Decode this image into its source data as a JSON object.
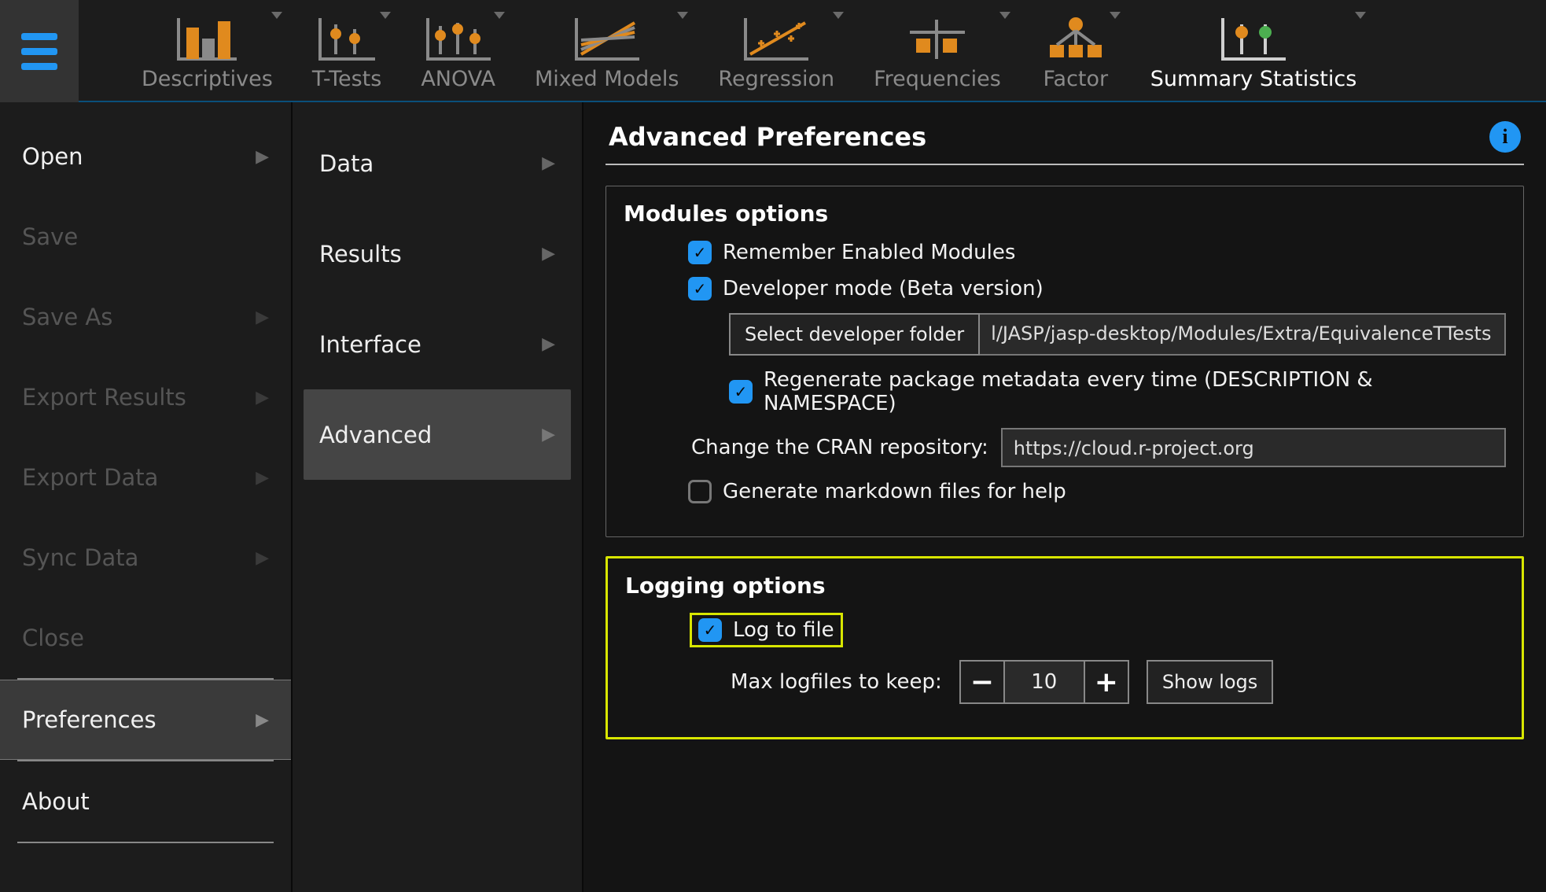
{
  "ribbon": {
    "items": [
      {
        "label": "Descriptives"
      },
      {
        "label": "T-Tests"
      },
      {
        "label": "ANOVA"
      },
      {
        "label": "Mixed Models"
      },
      {
        "label": "Regression"
      },
      {
        "label": "Frequencies"
      },
      {
        "label": "Factor"
      },
      {
        "label": "Summary Statistics"
      }
    ]
  },
  "left": {
    "items": [
      {
        "label": "Open"
      },
      {
        "label": "Save"
      },
      {
        "label": "Save As"
      },
      {
        "label": "Export Results"
      },
      {
        "label": "Export Data"
      },
      {
        "label": "Sync Data"
      },
      {
        "label": "Close"
      },
      {
        "label": "Preferences"
      },
      {
        "label": "About"
      }
    ]
  },
  "mid": {
    "items": [
      {
        "label": "Data"
      },
      {
        "label": "Results"
      },
      {
        "label": "Interface"
      },
      {
        "label": "Advanced"
      }
    ]
  },
  "main": {
    "title": "Advanced Preferences",
    "modules": {
      "title": "Modules options",
      "remember": "Remember Enabled Modules",
      "devmode": "Developer mode (Beta version)",
      "select_folder_btn": "Select developer folder",
      "folder_path": "l/JASP/jasp-desktop/Modules/Extra/EquivalenceTTests",
      "regenerate": "Regenerate package metadata every time (DESCRIPTION & NAMESPACE)",
      "cran_label": "Change the CRAN repository:",
      "cran_value": "https://cloud.r-project.org",
      "markdown": "Generate markdown files for help"
    },
    "logging": {
      "title": "Logging options",
      "log_to_file": "Log to file",
      "max_label": "Max logfiles to keep:",
      "max_value": "10",
      "show_logs": "Show logs"
    }
  }
}
